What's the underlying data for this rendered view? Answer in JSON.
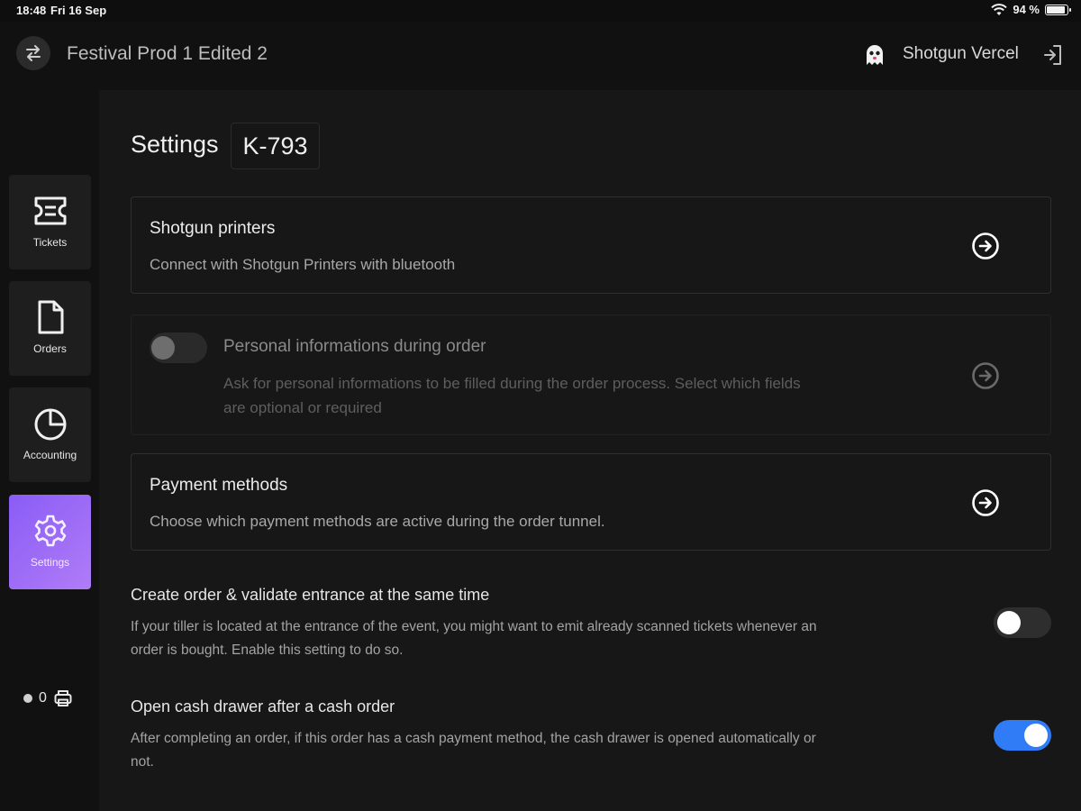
{
  "status_bar": {
    "time": "18:48",
    "date": "Fri 16 Sep",
    "battery": "94 %",
    "battery_level": 0.94
  },
  "header": {
    "event_title": "Festival Prod 1 Edited 2",
    "user_name": "Shotgun Vercel"
  },
  "sidebar": {
    "items": [
      {
        "label": "Tickets",
        "icon": "ticket-icon"
      },
      {
        "label": "Orders",
        "icon": "document-icon"
      },
      {
        "label": "Accounting",
        "icon": "pie-chart-icon"
      },
      {
        "label": "Settings",
        "icon": "gear-icon",
        "active": true
      }
    ],
    "printer_count": "0"
  },
  "main": {
    "title": "Settings",
    "device_code": "K-793",
    "cards": [
      {
        "title": "Shotgun printers",
        "description": "Connect with Shotgun Printers with bluetooth"
      },
      {
        "title": "Personal informations during order",
        "description_line1": "Ask for personal informations to be filled during the order process. Select which fields",
        "description_line2": "are optional or required",
        "enabled": false
      },
      {
        "title": "Payment methods",
        "description": "Choose which payment methods are active during the order tunnel."
      }
    ],
    "settings": [
      {
        "title": "Create order & validate entrance at the same time",
        "description_line1": "If your tiller is located at the entrance of the event, you might want to emit already scanned tickets whenever an",
        "description_line2": "order is bought. Enable this setting to do so.",
        "on": false
      },
      {
        "title": "Open cash drawer after a cash order",
        "description_line1": "After completing an order, if this order has a cash payment method, the cash drawer is opened automatically or",
        "description_line2": "not.",
        "on": true
      }
    ]
  },
  "colors": {
    "accent": "#8a5cf6",
    "toggle_on": "#2f7cf6",
    "background": "#171717"
  }
}
